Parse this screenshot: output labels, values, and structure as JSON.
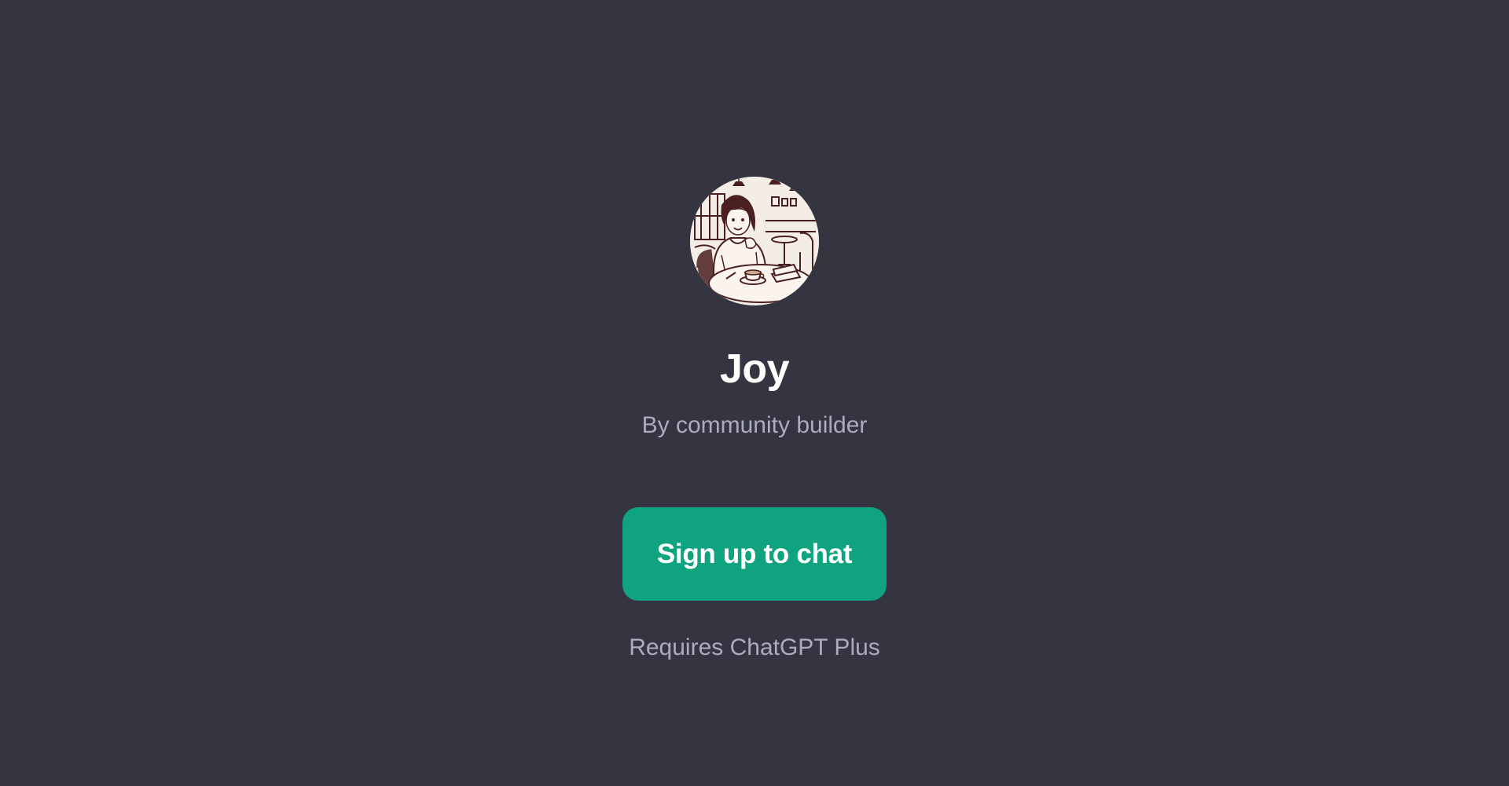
{
  "gpt": {
    "name": "Joy",
    "byline": "By community builder",
    "avatar_icon": "illustrated-woman-in-cafe-avatar"
  },
  "actions": {
    "signup_label": "Sign up to chat"
  },
  "footer": {
    "requirement_text": "Requires ChatGPT Plus"
  },
  "colors": {
    "background": "#343541",
    "accent": "#10a37f",
    "title": "#ffffff",
    "muted_text": "#acacbe",
    "illustration_ink": "#4a1f1f"
  }
}
